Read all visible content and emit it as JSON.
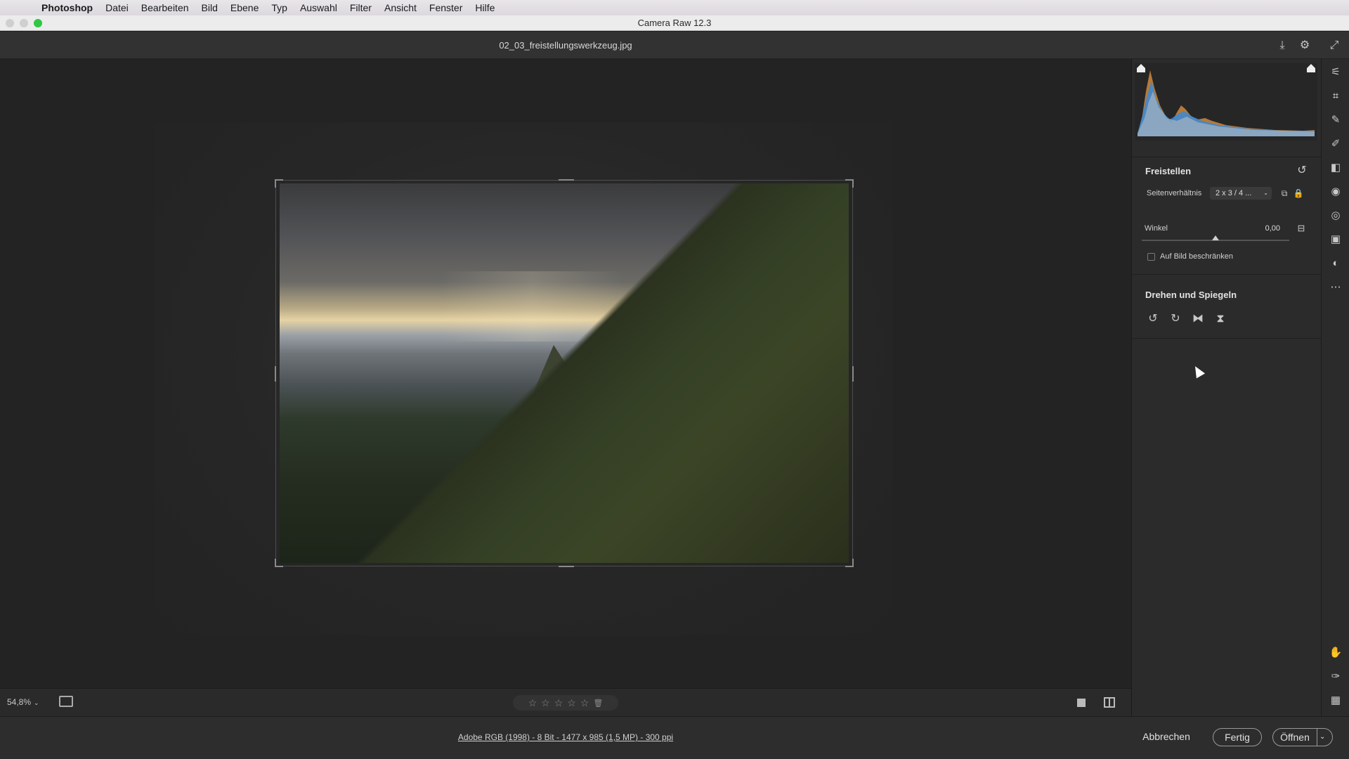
{
  "menubar": {
    "apple": "",
    "items": [
      "Photoshop",
      "Datei",
      "Bearbeiten",
      "Bild",
      "Ebene",
      "Typ",
      "Auswahl",
      "Filter",
      "Ansicht",
      "Fenster",
      "Hilfe"
    ]
  },
  "window": {
    "title": "Camera Raw 12.3"
  },
  "document": {
    "filename": "02_03_freistellungswerkzeug.jpg"
  },
  "toolbar_top": {
    "save_icon": "⤓",
    "settings_icon": "⚙",
    "fullscreen_icon": "⤢"
  },
  "bottom": {
    "zoom": "54,8%",
    "zoom_chev": "⌄",
    "stars": [
      "☆",
      "☆",
      "☆",
      "☆",
      "☆"
    ],
    "trash": "🗑"
  },
  "footer": {
    "info": "Adobe RGB (1998) - 8 Bit - 1477 x 985 (1,5 MP) - 300 ppi",
    "cancel": "Abbrechen",
    "done": "Fertig",
    "open": "Öffnen",
    "open_chev": "⌄"
  },
  "panel": {
    "crop": {
      "title": "Freistellen",
      "reset_icon": "↺",
      "ratio_label": "Seitenverhältnis",
      "ratio_value": "2 x 3  / 4 ...",
      "ratio_chev": "⌄",
      "angle_label": "Winkel",
      "angle_value": "0,00",
      "angle_level": 0.5,
      "constrain_label": "Auf Bild beschränken"
    },
    "rotate": {
      "title": "Drehen und Spiegeln",
      "icons": [
        "↺",
        "↻",
        "⧓",
        "⧗"
      ]
    }
  },
  "toolstrip": {
    "top_icons": [
      "⚟",
      "⌗",
      "✎",
      "✐",
      "◧",
      "◉",
      "◎",
      "▣",
      "◐",
      "⋯"
    ],
    "bottom_icons": [
      "✋",
      "✑",
      "▦"
    ]
  }
}
